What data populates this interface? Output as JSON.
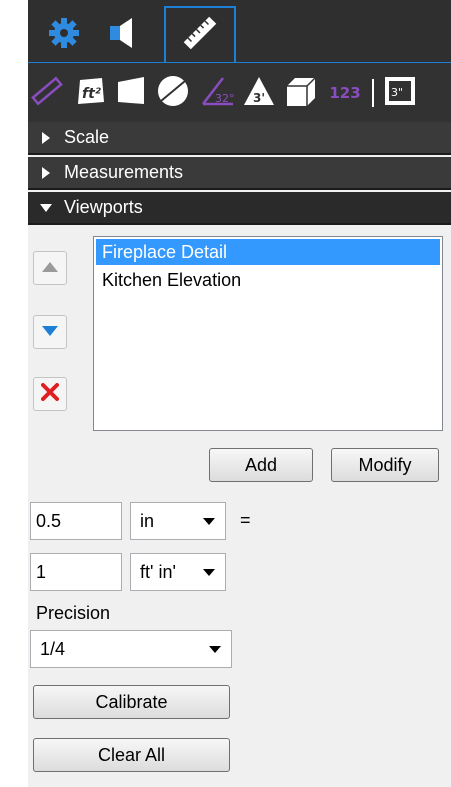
{
  "colors": {
    "accent": "#1e7fd6",
    "selection": "#3399ff",
    "header_bg": "#3a3a3a",
    "panel_bg": "#f0f0f0",
    "delete_red": "#e02020",
    "move_blue": "#1f7fd6"
  },
  "tabs": [
    {
      "icon": "gear-icon"
    },
    {
      "icon": "speaker-icon"
    },
    {
      "icon": "ruler-icon"
    }
  ],
  "toolbar_icons": [
    "ruler-length-icon",
    "area-ft2-icon",
    "polygon-icon",
    "circle-icon",
    "angle-icon",
    "triangle-icon",
    "box-volume-icon",
    "counter-icon",
    "scale-viewport-icon"
  ],
  "counter_label": "123",
  "sections": {
    "scale": "Scale",
    "measurements": "Measurements",
    "viewports": "Viewports"
  },
  "viewports": {
    "items": [
      "Fireplace Detail",
      "Kitchen Elevation"
    ],
    "selected": 0,
    "add_label": "Add",
    "modify_label": "Modify"
  },
  "scale_form": {
    "value1": "0.5",
    "unit1": "in",
    "equals": "=",
    "value2": "1",
    "unit2": "ft' in'",
    "precision_label": "Precision",
    "precision_value": "1/4",
    "calibrate_label": "Calibrate",
    "clear_label": "Clear All"
  }
}
